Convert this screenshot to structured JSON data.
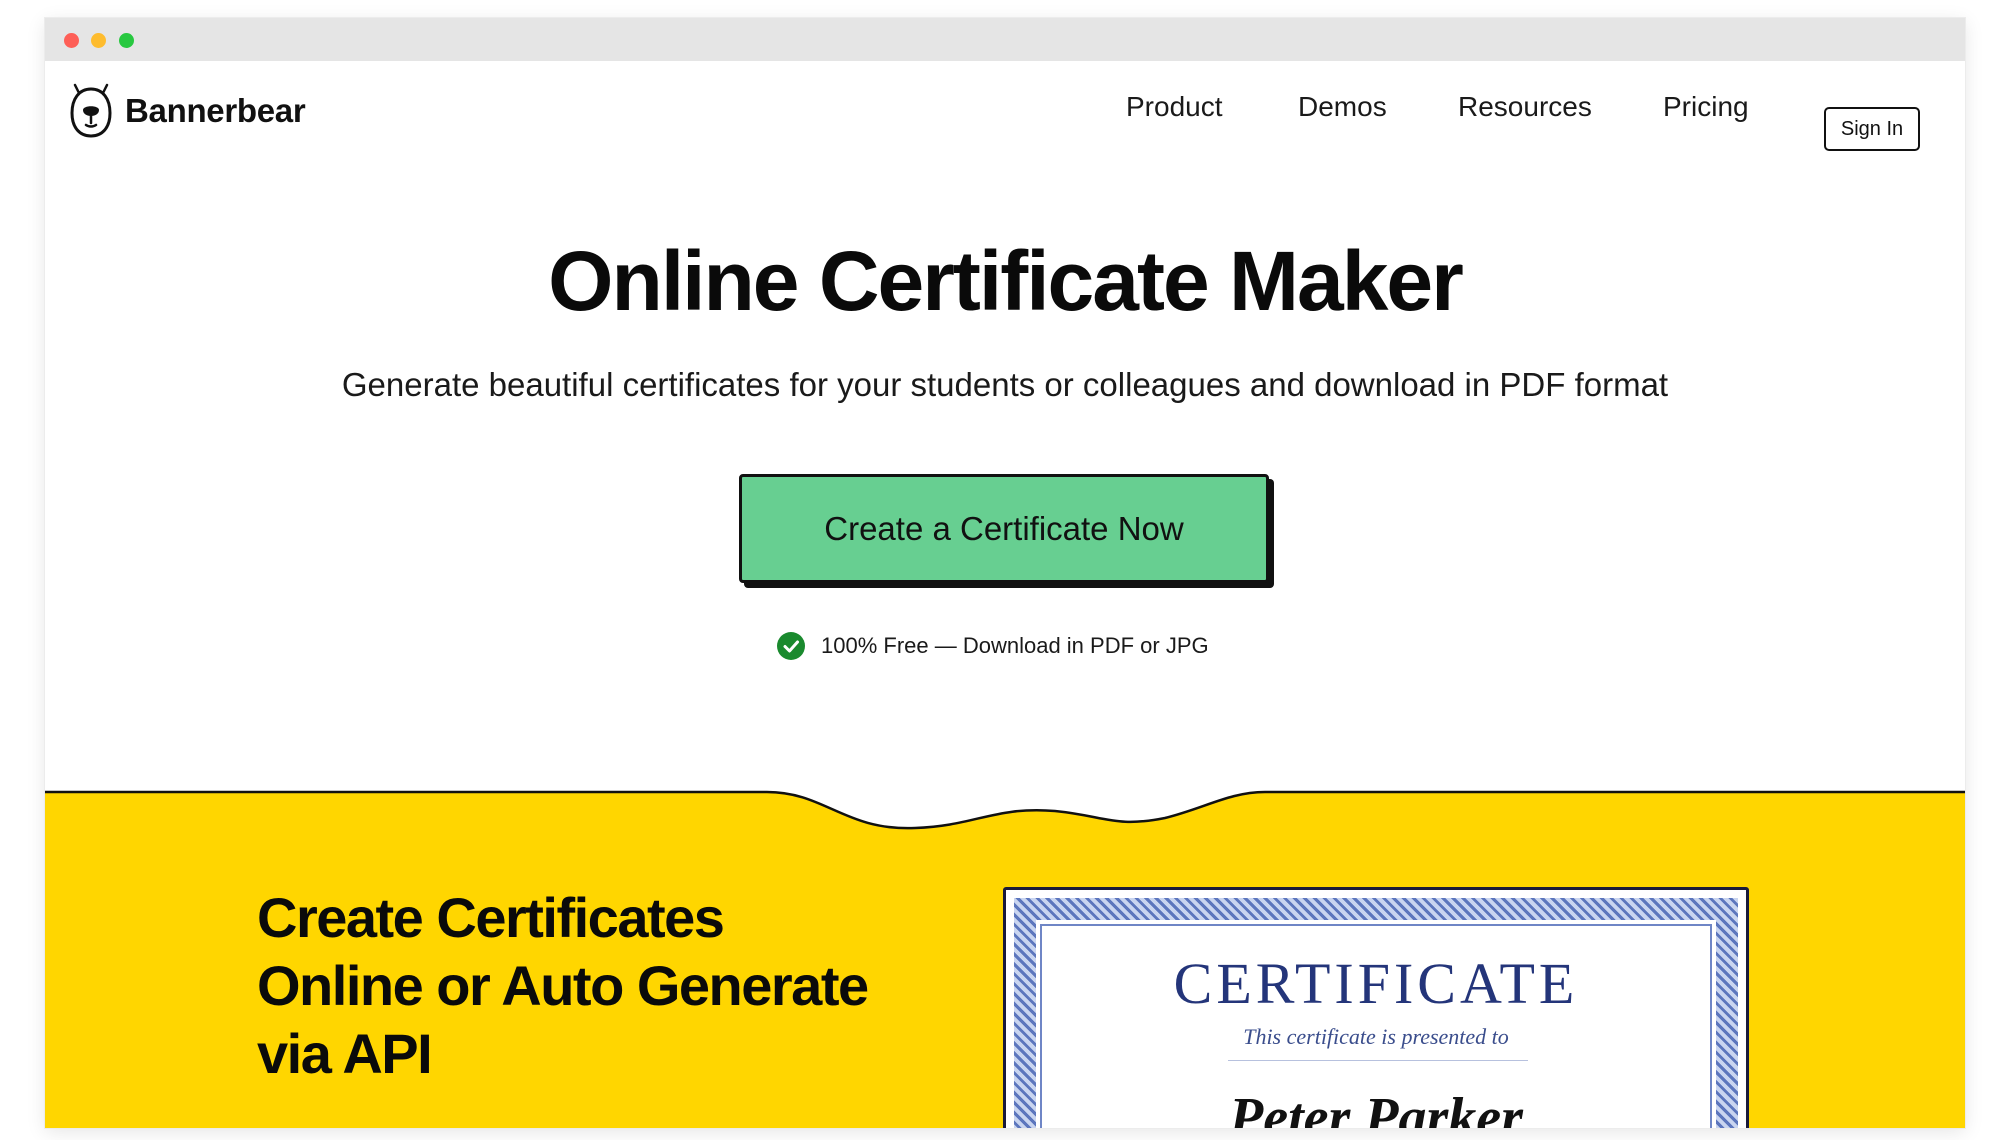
{
  "brand": {
    "name": "Bannerbear"
  },
  "nav": {
    "items": [
      {
        "label": "Product"
      },
      {
        "label": "Demos"
      },
      {
        "label": "Resources"
      },
      {
        "label": "Pricing"
      }
    ],
    "sign_in_label": "Sign In"
  },
  "hero": {
    "title": "Online Certificate Maker",
    "subtitle": "Generate beautiful certificates for your students or colleagues and download in PDF format",
    "cta_label": "Create a Certificate Now",
    "note": "100% Free — Download in PDF or JPG"
  },
  "section": {
    "title_lines": [
      "Create Certificates",
      "Online or Auto Generate",
      "via API"
    ]
  },
  "certificate": {
    "title": "CERTIFICATE",
    "subtitle": "This certificate is presented to",
    "name": "Peter Parker"
  },
  "colors": {
    "accent_green": "#67cf91",
    "section_yellow": "#ffd600",
    "check_green": "#1a8a2e",
    "cert_blue": "#24357a"
  },
  "icons": {
    "logo": "bear-icon",
    "note": "check-circle-icon"
  }
}
